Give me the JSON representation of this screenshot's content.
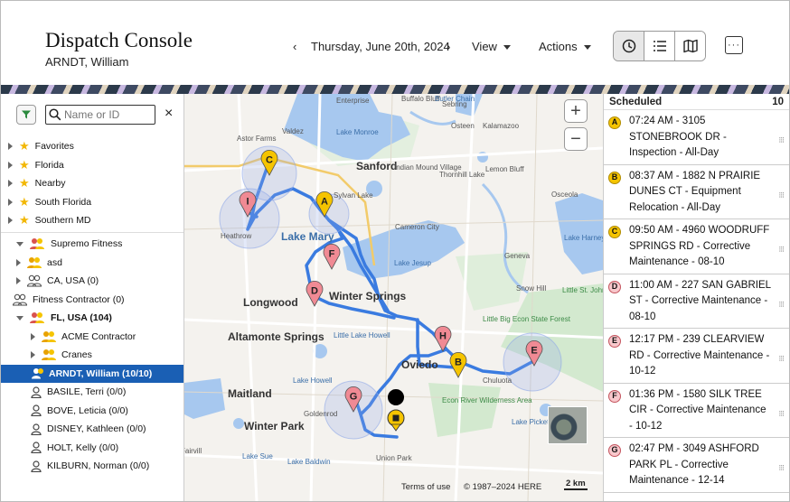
{
  "header": {
    "title": "Dispatch Console",
    "subtitle": "ARNDT, William",
    "prev_label": "‹",
    "date": "Thursday, June 20th, 2024",
    "next_label": "›",
    "view_label": "View",
    "actions_label": "Actions",
    "view_modes": [
      "clock-icon",
      "list-icon",
      "map-icon"
    ],
    "active_view_mode": "clock-icon",
    "more_label": "···"
  },
  "left_panel": {
    "search_placeholder": "Name or ID",
    "clear_label": "×",
    "tree": [
      {
        "label": "Favorites",
        "icon": "star-icon",
        "expander": "collapsed"
      },
      {
        "label": "Florida",
        "icon": "star-icon",
        "expander": "collapsed"
      },
      {
        "label": "Nearby",
        "icon": "star-icon",
        "expander": "collapsed"
      },
      {
        "label": "South Florida",
        "icon": "star-icon",
        "expander": "collapsed"
      },
      {
        "label": "Southern MD",
        "icon": "star-icon",
        "expander": "collapsed"
      },
      {
        "label": "Supremo Fitness",
        "icon": "group-alert-icon",
        "expander": "expanded"
      },
      {
        "label": "asd",
        "icon": "group-icon",
        "expander": "collapsed"
      },
      {
        "label": "CA, USA (0)",
        "icon": "group-outline-icon",
        "expander": "collapsed"
      },
      {
        "label": "Fitness Contractor (0)",
        "icon": "group-outline-icon",
        "expander": "none"
      },
      {
        "label": "FL, USA (104)",
        "icon": "group-alert-icon",
        "expander": "expanded"
      },
      {
        "label": "ACME Contractor",
        "icon": "group-icon",
        "expander": "collapsed"
      },
      {
        "label": "Cranes",
        "icon": "group-icon",
        "expander": "collapsed"
      },
      {
        "label": "ARNDT, William (10/10)",
        "icon": "user-alert-icon",
        "expander": "none"
      },
      {
        "label": "BASILE, Terri (0/0)",
        "icon": "user-icon",
        "expander": "none"
      },
      {
        "label": "BOVE, Leticia (0/0)",
        "icon": "user-icon",
        "expander": "none"
      },
      {
        "label": "DISNEY, Kathleen (0/0)",
        "icon": "user-icon",
        "expander": "none"
      },
      {
        "label": "HOLT, Kelly (0/0)",
        "icon": "user-icon",
        "expander": "none"
      },
      {
        "label": "KILBURN, Norman (0/0)",
        "icon": "user-icon",
        "expander": "none"
      }
    ]
  },
  "map": {
    "zoom_in": "+",
    "zoom_out": "−",
    "labels": [
      "Enterprise",
      "Buffalo Bluff",
      "Sebring",
      "Butler Chain",
      "Valdez",
      "Lake Monroe",
      "Osteen",
      "Kalamazoo",
      "Astor Farms",
      "Sanford",
      "Indian Mound Village",
      "Thornhill Lake",
      "Lemon Bluff",
      "Sylvan Lake",
      "Osceola",
      "Heathrow",
      "Lake Mary",
      "Cameron City",
      "Lake Harney",
      "Geneva",
      "Lake Jesup",
      "Snow Hill",
      "Longwood",
      "Winter Springs",
      "Little St. Johns Forest",
      "Altamonte Springs",
      "Little Lake Howell",
      "Little Big Econ State Forest",
      "Oviedo",
      "Chuluota",
      "Lake Howell",
      "Maitland",
      "Goldenrod",
      "Econ River Wilderness Area",
      "Lake Pickett",
      "Winter Park",
      "Union Park",
      "Fairvill",
      "Lake Sue",
      "Lake Baldwin"
    ],
    "terms": "Terms of use",
    "copyright": "© 1987–2024 HERE",
    "scale": "2 km",
    "markers": [
      {
        "letter": "C",
        "kind": "yellow"
      },
      {
        "letter": "I",
        "kind": "pink"
      },
      {
        "letter": "A",
        "kind": "yellow"
      },
      {
        "letter": "F",
        "kind": "pink"
      },
      {
        "letter": "D",
        "kind": "pink"
      },
      {
        "letter": "H",
        "kind": "pink"
      },
      {
        "letter": "B",
        "kind": "yellow"
      },
      {
        "letter": "E",
        "kind": "pink"
      },
      {
        "letter": "G",
        "kind": "pink"
      }
    ],
    "colors": {
      "route": "#3a7be0",
      "water": "#a7c8ef",
      "land": "#f4f2ee",
      "forest": "#d3e9cf",
      "yellow_pin": "#f5c400",
      "pink_pin": "#f08a94"
    }
  },
  "right_panel": {
    "title": "Scheduled",
    "count": "10",
    "jobs": [
      {
        "badge": "A",
        "badge_color": "#f5c400",
        "text": "07:24 AM - 3105 STONEBROOK DR - Inspection - All-Day"
      },
      {
        "badge": "B",
        "badge_color": "#f5c400",
        "text": "08:37 AM - 1882 N PRAIRIE DUNES CT - Equipment Relocation - All-Day"
      },
      {
        "badge": "C",
        "badge_color": "#f5c400",
        "text": "09:50 AM - 4960 WOODRUFF SPRINGS RD - Corrective Maintenance - 08-10"
      },
      {
        "badge": "D",
        "badge_color": "#f8c8cc",
        "text": "11:00 AM - 227 SAN GABRIEL ST - Corrective Maintenance - 08-10"
      },
      {
        "badge": "E",
        "badge_color": "#f8c8cc",
        "text": "12:17 PM - 239 CLEARVIEW RD - Corrective Maintenance - 10-12"
      },
      {
        "badge": "F",
        "badge_color": "#f8c8cc",
        "text": "01:36 PM - 1580 SILK TREE CIR - Corrective Maintenance - 10-12"
      },
      {
        "badge": "G",
        "badge_color": "#f8c8cc",
        "text": "02:47 PM - 3049 ASHFORD PARK PL - Corrective Maintenance - 12-14"
      }
    ]
  }
}
